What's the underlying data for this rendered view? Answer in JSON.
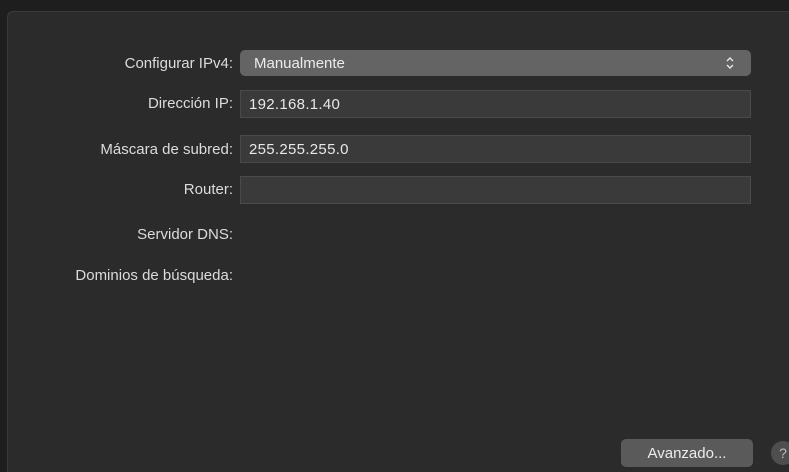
{
  "form": {
    "ipv4_label": "Configurar IPv4:",
    "ipv4_value": "Manualmente",
    "ip_label": "Dirección IP:",
    "ip_value": "192.168.1.40",
    "mask_label": "Máscara de subred:",
    "mask_value": "255.255.255.0",
    "router_label": "Router:",
    "router_value": "",
    "dns_label": "Servidor DNS:",
    "domains_label": "Dominios de búsqueda:"
  },
  "buttons": {
    "advanced_label": "Avanzado...",
    "help_label": "?"
  },
  "icons": {
    "select_arrows": "chevron-up-down-icon"
  }
}
